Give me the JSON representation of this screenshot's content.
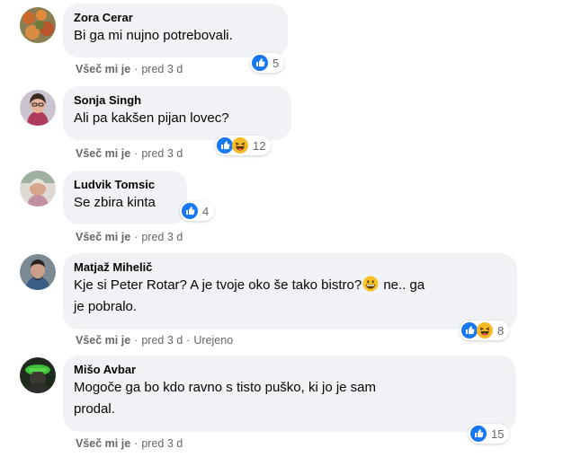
{
  "colors": {
    "bubble": "#f0f2f5",
    "meta": "#65676b",
    "like_blue": "#1877f2",
    "haha_yellow": "#f7b928"
  },
  "comments": [
    {
      "author": "Zora Cerar",
      "lines": [
        "Bi ga mi nujno potrebovali."
      ],
      "like_label": "Všeč mi je",
      "time": "pred 3 d",
      "reactions": [
        "like-icon"
      ],
      "reaction_count": "5"
    },
    {
      "author": "Sonja Singh",
      "lines": [
        "Ali pa kakšen pijan lovec?"
      ],
      "like_label": "Všeč mi je",
      "time": "pred 3 d",
      "reactions": [
        "like-icon",
        "haha-icon"
      ],
      "reaction_count": "12"
    },
    {
      "author": "Ludvik Tomsic",
      "lines": [
        "Se zbira kinta"
      ],
      "like_label": "Všeč mi je",
      "time": "pred 3 d",
      "reactions": [
        "like-icon"
      ],
      "reaction_count": "4"
    },
    {
      "author": "Matjaž Mihelič",
      "line1_text": "Kje si Peter Rotar? A je tvoje oko še tako bistro?",
      "line1_after": " ne.. ga",
      "line2": "je pobralo.",
      "inline_emoji": "grinning-face-emoji",
      "like_label": "Všeč mi je",
      "time": "pred 3 d",
      "edited": "Urejeno",
      "reactions": [
        "like-icon",
        "haha-icon"
      ],
      "reaction_count": "8"
    },
    {
      "author": "Mišo Avbar",
      "lines": [
        "Mogoče ga bo kdo ravno s tisto puško, ki jo je sam",
        "prodal."
      ],
      "like_label": "Všeč mi je",
      "time": "pred 3 d",
      "reactions": [
        "like-icon"
      ],
      "reaction_count": "15"
    }
  ]
}
